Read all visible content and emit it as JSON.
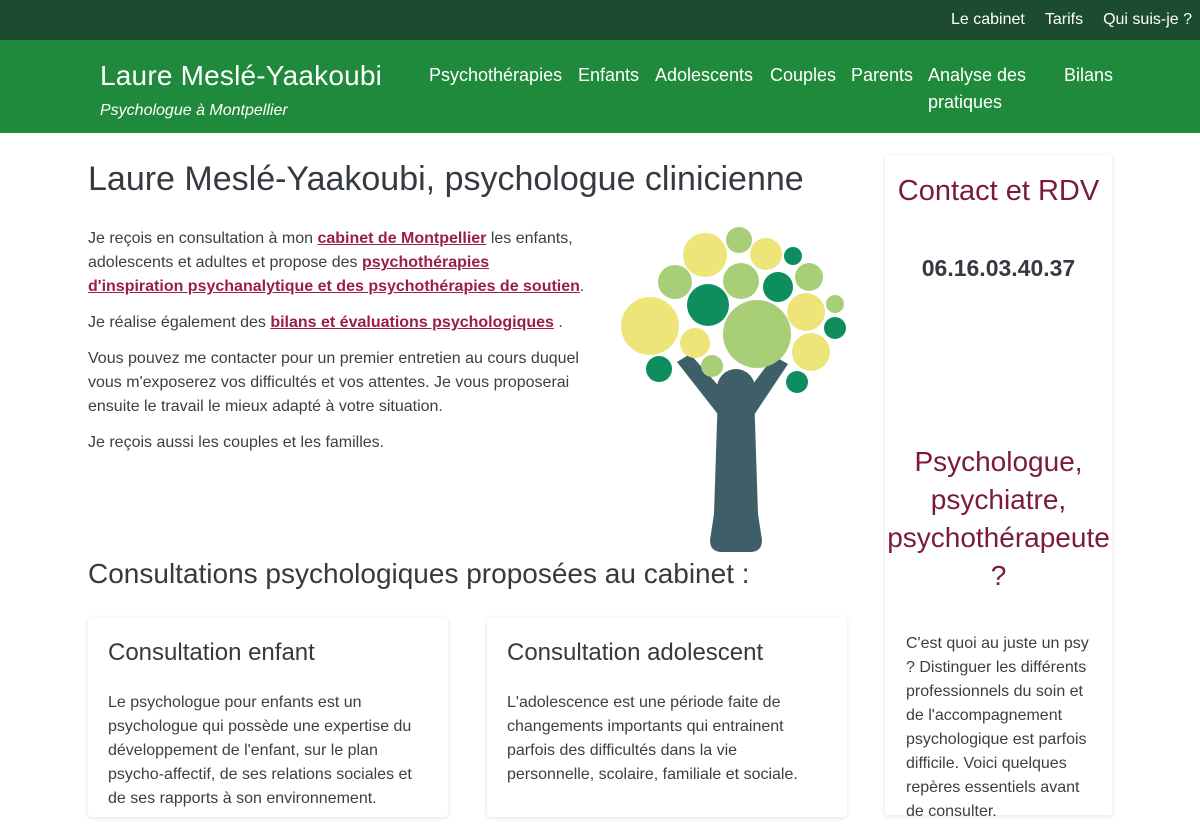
{
  "topnav": {
    "items": [
      "Le cabinet",
      "Tarifs",
      "Qui suis-je ?"
    ]
  },
  "brand": {
    "title": "Laure Meslé-Yaakoubi",
    "subtitle": "Psychologue à Montpellier"
  },
  "mainnav": {
    "items": [
      "Psychothérapies",
      "Enfants",
      "Adolescents",
      "Couples",
      "Parents",
      "Analyse des pratiques",
      "Bilans"
    ]
  },
  "main": {
    "title": "Laure Meslé-Yaakoubi, psychologue clinicienne",
    "p1": {
      "before": "Je reçois en consultation à mon ",
      "link1": "cabinet de Montpellier",
      "mid": " les enfants, adolescents et adultes et propose des ",
      "link2": "psychothérapies d'inspiration psychanalytique et des psychothérapies de soutien",
      "after": "."
    },
    "p2": {
      "before": "Je réalise également des ",
      "link": "bilans et évaluations psychologiques",
      "after": " ."
    },
    "p3": "Vous pouvez me contacter pour un premier entretien au cours duquel vous m'exposerez vos difficultés et vos attentes. Je vous proposerai ensuite le travail le mieux adapté à votre situation.",
    "p4": "Je reçois aussi les couples et les familles.",
    "section_title": "Consultations psychologiques proposées au cabinet :",
    "cards": [
      {
        "title": "Consultation enfant",
        "text": "Le psychologue pour enfants est un psychologue qui possède une expertise du développement de l'enfant, sur le plan psycho-affectif, de ses relations sociales et de ses rapports à son environnement."
      },
      {
        "title": "Consultation adolescent",
        "text": "L'adolescence est une période faite de changements importants qui entrainent parfois des difficultés dans la vie personnelle, scolaire, familiale et sociale."
      }
    ]
  },
  "sidebar": {
    "contact_title": "Contact et RDV",
    "phone": "06.16.03.40.37",
    "heading": "Psychologue, psychiatre, psychothérapeute ?",
    "text": "C'est quoi au juste un psy ? Distinguer les différents professionnels du soin et de l'accompagnement psychologique est parfois difficile. Voici quelques repères essentiels avant de consulter."
  },
  "colors": {
    "topbar": "#1c4b2f",
    "navbar": "#1f8a3b",
    "link": "#9c1c4a",
    "sidebar_heading": "#7a1a3c",
    "tree_trunk": "#3e5f68",
    "leaf_dark": "#0e8e5e",
    "leaf_light": "#a8cf78",
    "leaf_yellow": "#ede57a"
  },
  "icons": {
    "logo": "tree-logo-icon"
  }
}
